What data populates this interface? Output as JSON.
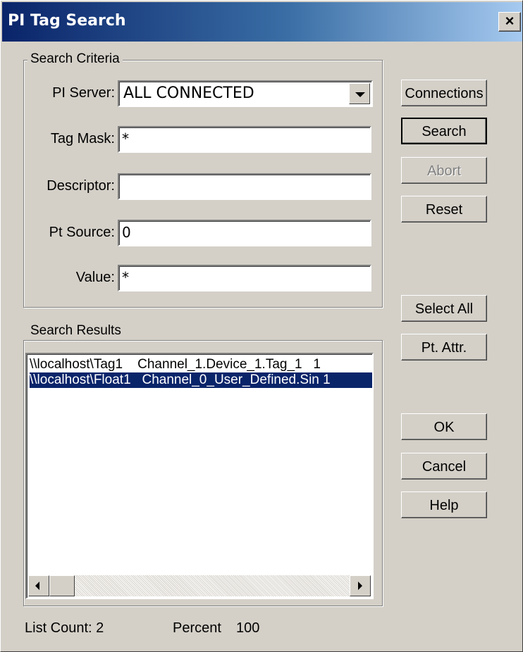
{
  "window": {
    "title": "PI Tag Search",
    "close_label": "×"
  },
  "search_criteria": {
    "legend": "Search Criteria",
    "pi_server": {
      "label": "PI Server:",
      "value": "ALL CONNECTED"
    },
    "tag_mask": {
      "label": "Tag Mask:",
      "value": "*"
    },
    "descriptor": {
      "label": "Descriptor:",
      "value": ""
    },
    "pt_source": {
      "label": "Pt Source:",
      "value": "0"
    },
    "value": {
      "label": "Value:",
      "value": "*"
    }
  },
  "buttons": {
    "connections": "Connections",
    "search": "Search",
    "abort": "Abort",
    "reset": "Reset",
    "select_all": "Select All",
    "pt_attr": "Pt. Attr.",
    "ok": "OK",
    "cancel": "Cancel",
    "help": "Help"
  },
  "search_results": {
    "legend": "Search Results",
    "rows": [
      {
        "text": "\\\\localhost\\Tag1    Channel_1.Device_1.Tag_1   1",
        "selected": false
      },
      {
        "text": "\\\\localhost\\Float1   Channel_0_User_Defined.Sin 1",
        "selected": true
      }
    ]
  },
  "status": {
    "list_count_label": "List Count: 2",
    "percent_label": "Percent",
    "percent_value": "100"
  }
}
